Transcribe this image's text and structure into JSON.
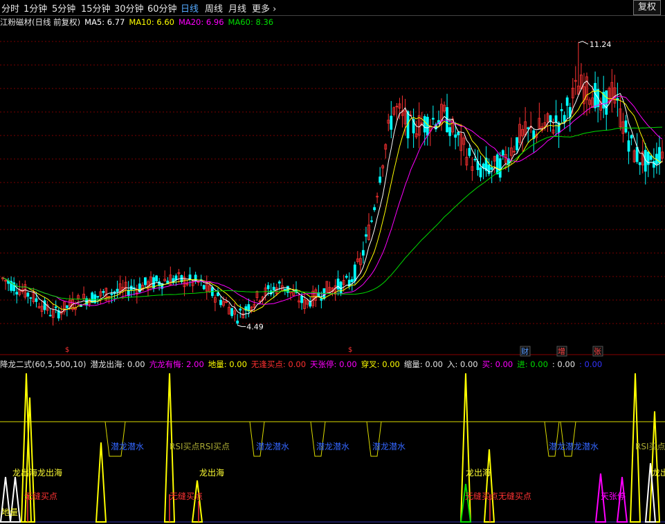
{
  "toolbar": {
    "periods": [
      {
        "label": "分时",
        "x": 2
      },
      {
        "label": "1分钟",
        "x": 34
      },
      {
        "label": "5分钟",
        "x": 75
      },
      {
        "label": "15分钟",
        "x": 117
      },
      {
        "label": "30分钟",
        "x": 165
      },
      {
        "label": "60分钟",
        "x": 213
      },
      {
        "label": "日线",
        "x": 261
      },
      {
        "label": "周线",
        "x": 296
      },
      {
        "label": "月线",
        "x": 330
      },
      {
        "label": "更多 ›",
        "x": 364
      }
    ],
    "active_index": 6,
    "restore_label": "复权"
  },
  "main_header": {
    "name": "江粉磁材(日线 前复权)",
    "ma": [
      {
        "label": "MA5: 6.77",
        "color": "#ffffff"
      },
      {
        "label": "MA10: 6.60",
        "color": "#ffff00"
      },
      {
        "label": "MA20: 6.96",
        "color": "#ff00ff"
      },
      {
        "label": "MA60: 8.36",
        "color": "#00dd00"
      }
    ]
  },
  "price_labels": {
    "high": "11.24",
    "low": "4.49"
  },
  "event_markers": [
    {
      "label": "财",
      "color": "#5599ff"
    },
    {
      "label": "增",
      "color": "#ff4444"
    },
    {
      "label": "张",
      "color": "#ff4444"
    }
  ],
  "indicator_header": [
    {
      "label": "降龙二式(60,5,500,10)",
      "color": "#e6e6e6"
    },
    {
      "label": "潜龙出海: 0.00",
      "color": "#e6e6e6"
    },
    {
      "label": "亢龙有悔: 2.00",
      "color": "#ff00ff"
    },
    {
      "label": "地量: 0.00",
      "color": "#ffff00"
    },
    {
      "label": "无逢买点: 0.00",
      "color": "#ff3030"
    },
    {
      "label": "天张停: 0.00",
      "color": "#ff00ff"
    },
    {
      "label": "穿叉: 0.00",
      "color": "#ffff00"
    },
    {
      "label": "缩量: 0.00",
      "color": "#e6e6e6"
    },
    {
      "label": "入: 0.00",
      "color": "#e6e6e6"
    },
    {
      "label": "买: 0.00",
      "color": "#ff00ff"
    },
    {
      "label": "进: 0.00",
      "color": "#00dd00"
    },
    {
      "label": ": 0.00",
      "color": "#e6e6e6"
    },
    {
      "label": ": 0.00",
      "color": "#3333ff"
    }
  ],
  "indicator_labels": [
    {
      "text": "潜龙潜水",
      "color": "#3366ff"
    },
    {
      "text": "RSI买点RSI买点",
      "color": "#aaaa33"
    },
    {
      "text": "潜龙潜水",
      "color": "#3366ff"
    },
    {
      "text": "潜龙潜水",
      "color": "#3366ff"
    },
    {
      "text": "潜龙潜水",
      "color": "#3366ff"
    },
    {
      "text": "潜龙潜龙潜水",
      "color": "#3366ff"
    },
    {
      "text": "RSI买点",
      "color": "#aaaa33"
    },
    {
      "text": "龙出海龙出海",
      "color": "#ffff33"
    },
    {
      "text": "龙出海",
      "color": "#ffff33"
    },
    {
      "text": "龙出海",
      "color": "#ffff33"
    },
    {
      "text": "龙出海",
      "color": "#ffff33"
    },
    {
      "text": "无缝买点",
      "color": "#ff3333"
    },
    {
      "text": "无缝买点",
      "color": "#ff3333"
    },
    {
      "text": "无缝买点无缝买点",
      "color": "#ff3333"
    },
    {
      "text": "天张停",
      "color": "#ff00ff"
    },
    {
      "text": "地量",
      "color": "#ffff33"
    }
  ],
  "chart_data": {
    "type": "candlestick",
    "ylim": [
      4.0,
      11.6
    ],
    "low": 4.49,
    "high": 11.24,
    "anchors_close": [
      [
        0,
        5.6
      ],
      [
        10,
        5.2
      ],
      [
        18,
        4.75
      ],
      [
        28,
        5.1
      ],
      [
        45,
        5.35
      ],
      [
        60,
        5.6
      ],
      [
        70,
        5.5
      ],
      [
        80,
        5.0
      ],
      [
        84,
        4.7
      ],
      [
        92,
        5.2
      ],
      [
        100,
        5.45
      ],
      [
        108,
        5.0
      ],
      [
        116,
        5.35
      ],
      [
        124,
        5.5
      ],
      [
        128,
        6.0
      ],
      [
        132,
        7.0
      ],
      [
        136,
        8.5
      ],
      [
        140,
        9.7
      ],
      [
        146,
        9.2
      ],
      [
        150,
        9.3
      ],
      [
        158,
        9.5
      ],
      [
        164,
        8.8
      ],
      [
        170,
        8.2
      ],
      [
        178,
        8.3
      ],
      [
        185,
        9.0
      ],
      [
        193,
        9.2
      ],
      [
        200,
        9.4
      ],
      [
        206,
        10.2
      ],
      [
        212,
        10.0
      ],
      [
        214,
        9.6
      ],
      [
        218,
        10.1
      ],
      [
        222,
        9.3
      ],
      [
        226,
        8.6
      ],
      [
        232,
        8.3
      ],
      [
        236,
        8.7
      ]
    ],
    "count": 237
  }
}
